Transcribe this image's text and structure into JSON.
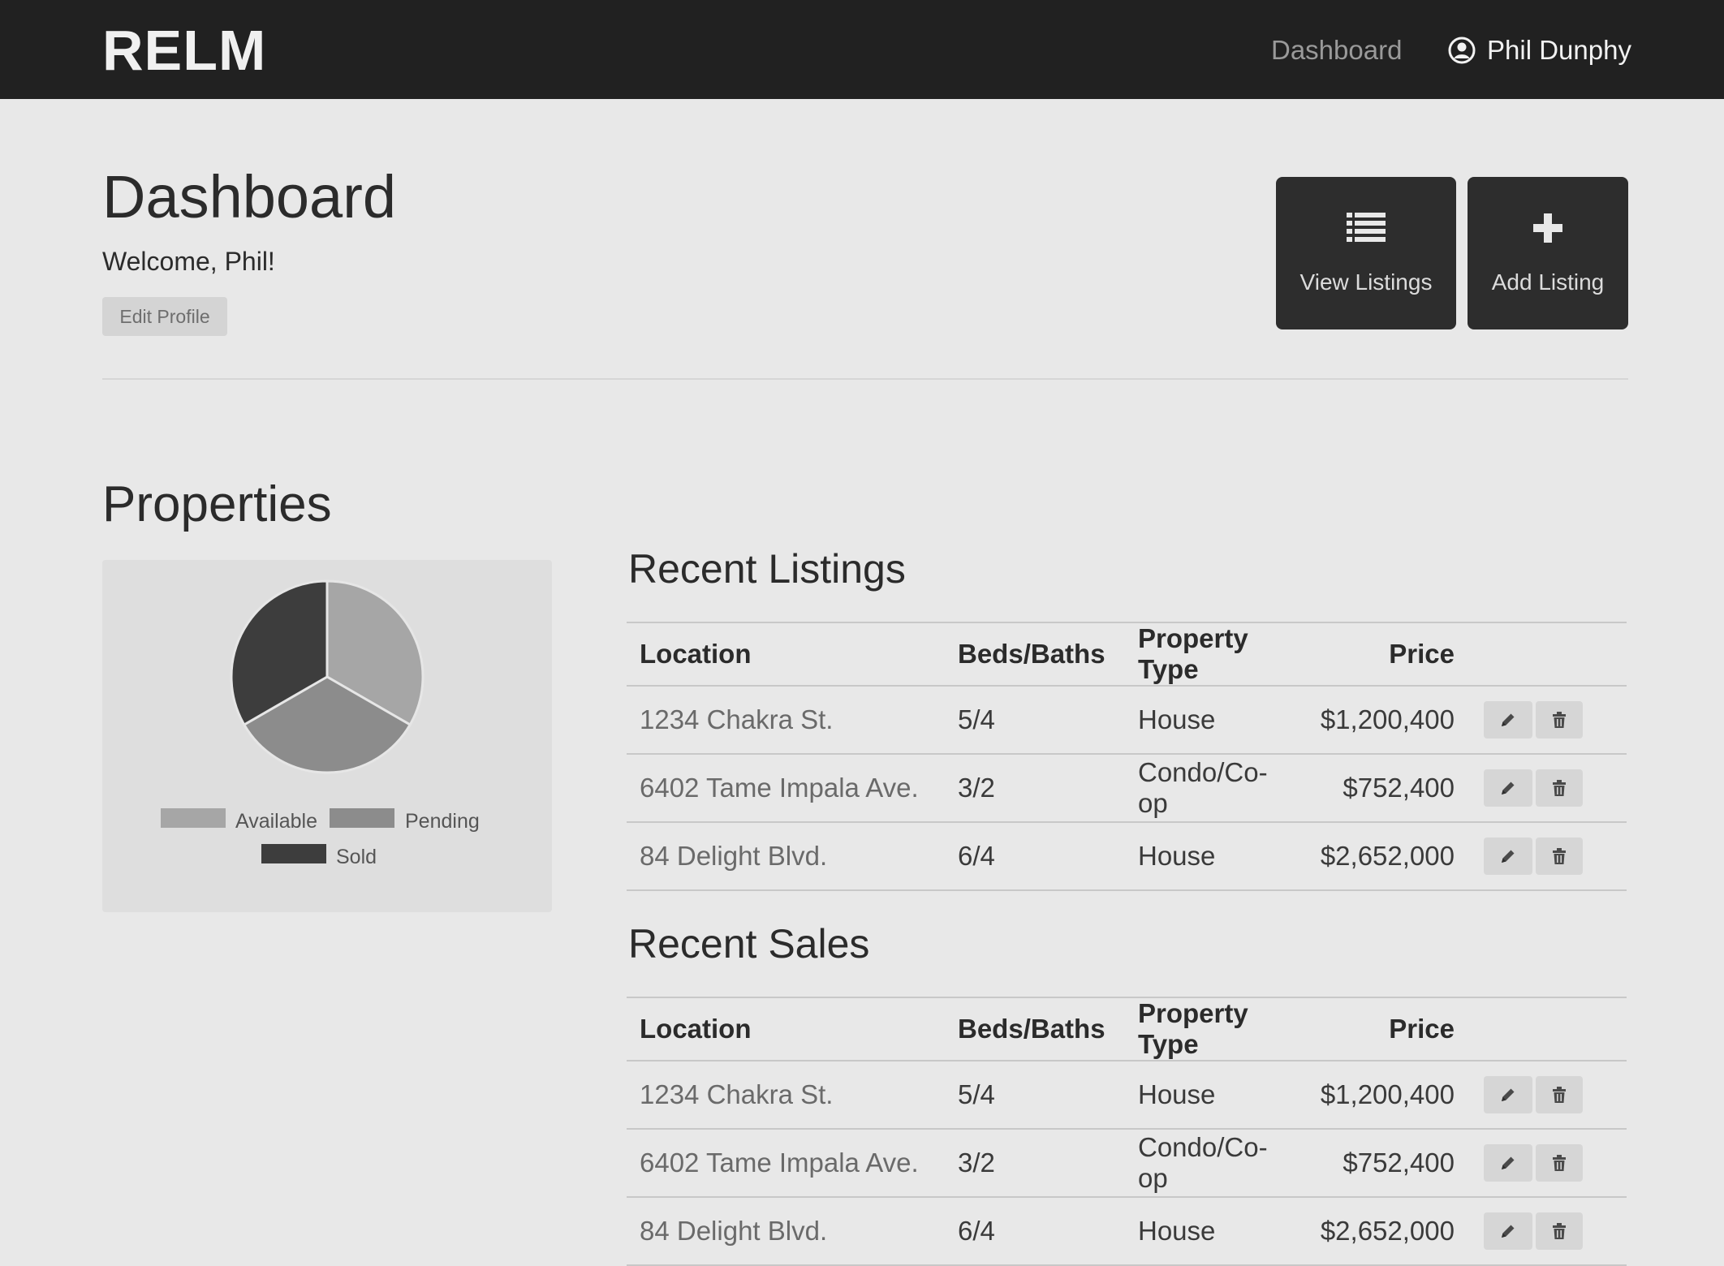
{
  "nav": {
    "brand": "RELM",
    "dashboard_link": "Dashboard",
    "user_name": "Phil Dunphy",
    "user_icon": "user-circle-icon"
  },
  "header": {
    "title": "Dashboard",
    "welcome": "Welcome, Phil!",
    "edit_profile": "Edit Profile",
    "view_listings": "View Listings",
    "view_listings_icon": "list-icon",
    "add_listing": "Add Listing",
    "add_listing_icon": "plus-icon"
  },
  "properties": {
    "title": "Properties"
  },
  "chart_data": {
    "type": "pie",
    "slices": [
      {
        "label": "Available",
        "value": 1,
        "color": "#a6a6a6"
      },
      {
        "label": "Pending",
        "value": 1,
        "color": "#8c8c8c"
      },
      {
        "label": "Sold",
        "value": 1,
        "color": "#3d3d3d"
      }
    ],
    "legend": [
      "Available",
      "Pending",
      "Sold"
    ],
    "legend_position": "bottom"
  },
  "recent_listings": {
    "title": "Recent Listings",
    "columns": [
      "Location",
      "Beds/Baths",
      "Property Type",
      "Price"
    ],
    "rows": [
      {
        "location": "1234 Chakra St.",
        "beds_baths": "5/4",
        "type": "House",
        "price": "$1,200,400"
      },
      {
        "location": "6402 Tame Impala Ave.",
        "beds_baths": "3/2",
        "type": "Condo/Co-op",
        "price": "$752,400"
      },
      {
        "location": "84 Delight Blvd.",
        "beds_baths": "6/4",
        "type": "House",
        "price": "$2,652,000"
      }
    ]
  },
  "recent_sales": {
    "title": "Recent Sales",
    "columns": [
      "Location",
      "Beds/Baths",
      "Property Type",
      "Price"
    ],
    "rows": [
      {
        "location": "1234 Chakra St.",
        "beds_baths": "5/4",
        "type": "House",
        "price": "$1,200,400"
      },
      {
        "location": "6402 Tame Impala Ave.",
        "beds_baths": "3/2",
        "type": "Condo/Co-op",
        "price": "$752,400"
      },
      {
        "location": "84 Delight Blvd.",
        "beds_baths": "6/4",
        "type": "House",
        "price": "$2,652,000"
      }
    ]
  },
  "row_actions": {
    "edit_icon": "pencil-icon",
    "delete_icon": "trash-icon"
  }
}
